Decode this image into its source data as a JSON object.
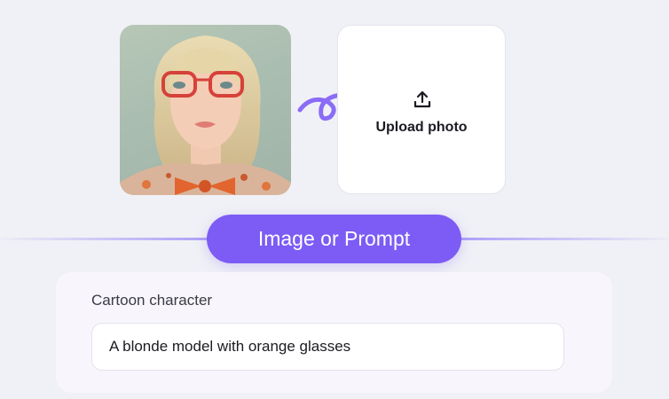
{
  "upload": {
    "label": "Upload photo",
    "icon": "upload-icon"
  },
  "sample_image": {
    "alt": "portrait"
  },
  "cta": {
    "label": "Image or Prompt"
  },
  "prompt": {
    "title": "Cartoon character",
    "value": "A blonde model with orange glasses"
  },
  "colors": {
    "accent": "#7c5cf5",
    "background": "#f0f1f6",
    "arrow": "#8a6cf7"
  }
}
